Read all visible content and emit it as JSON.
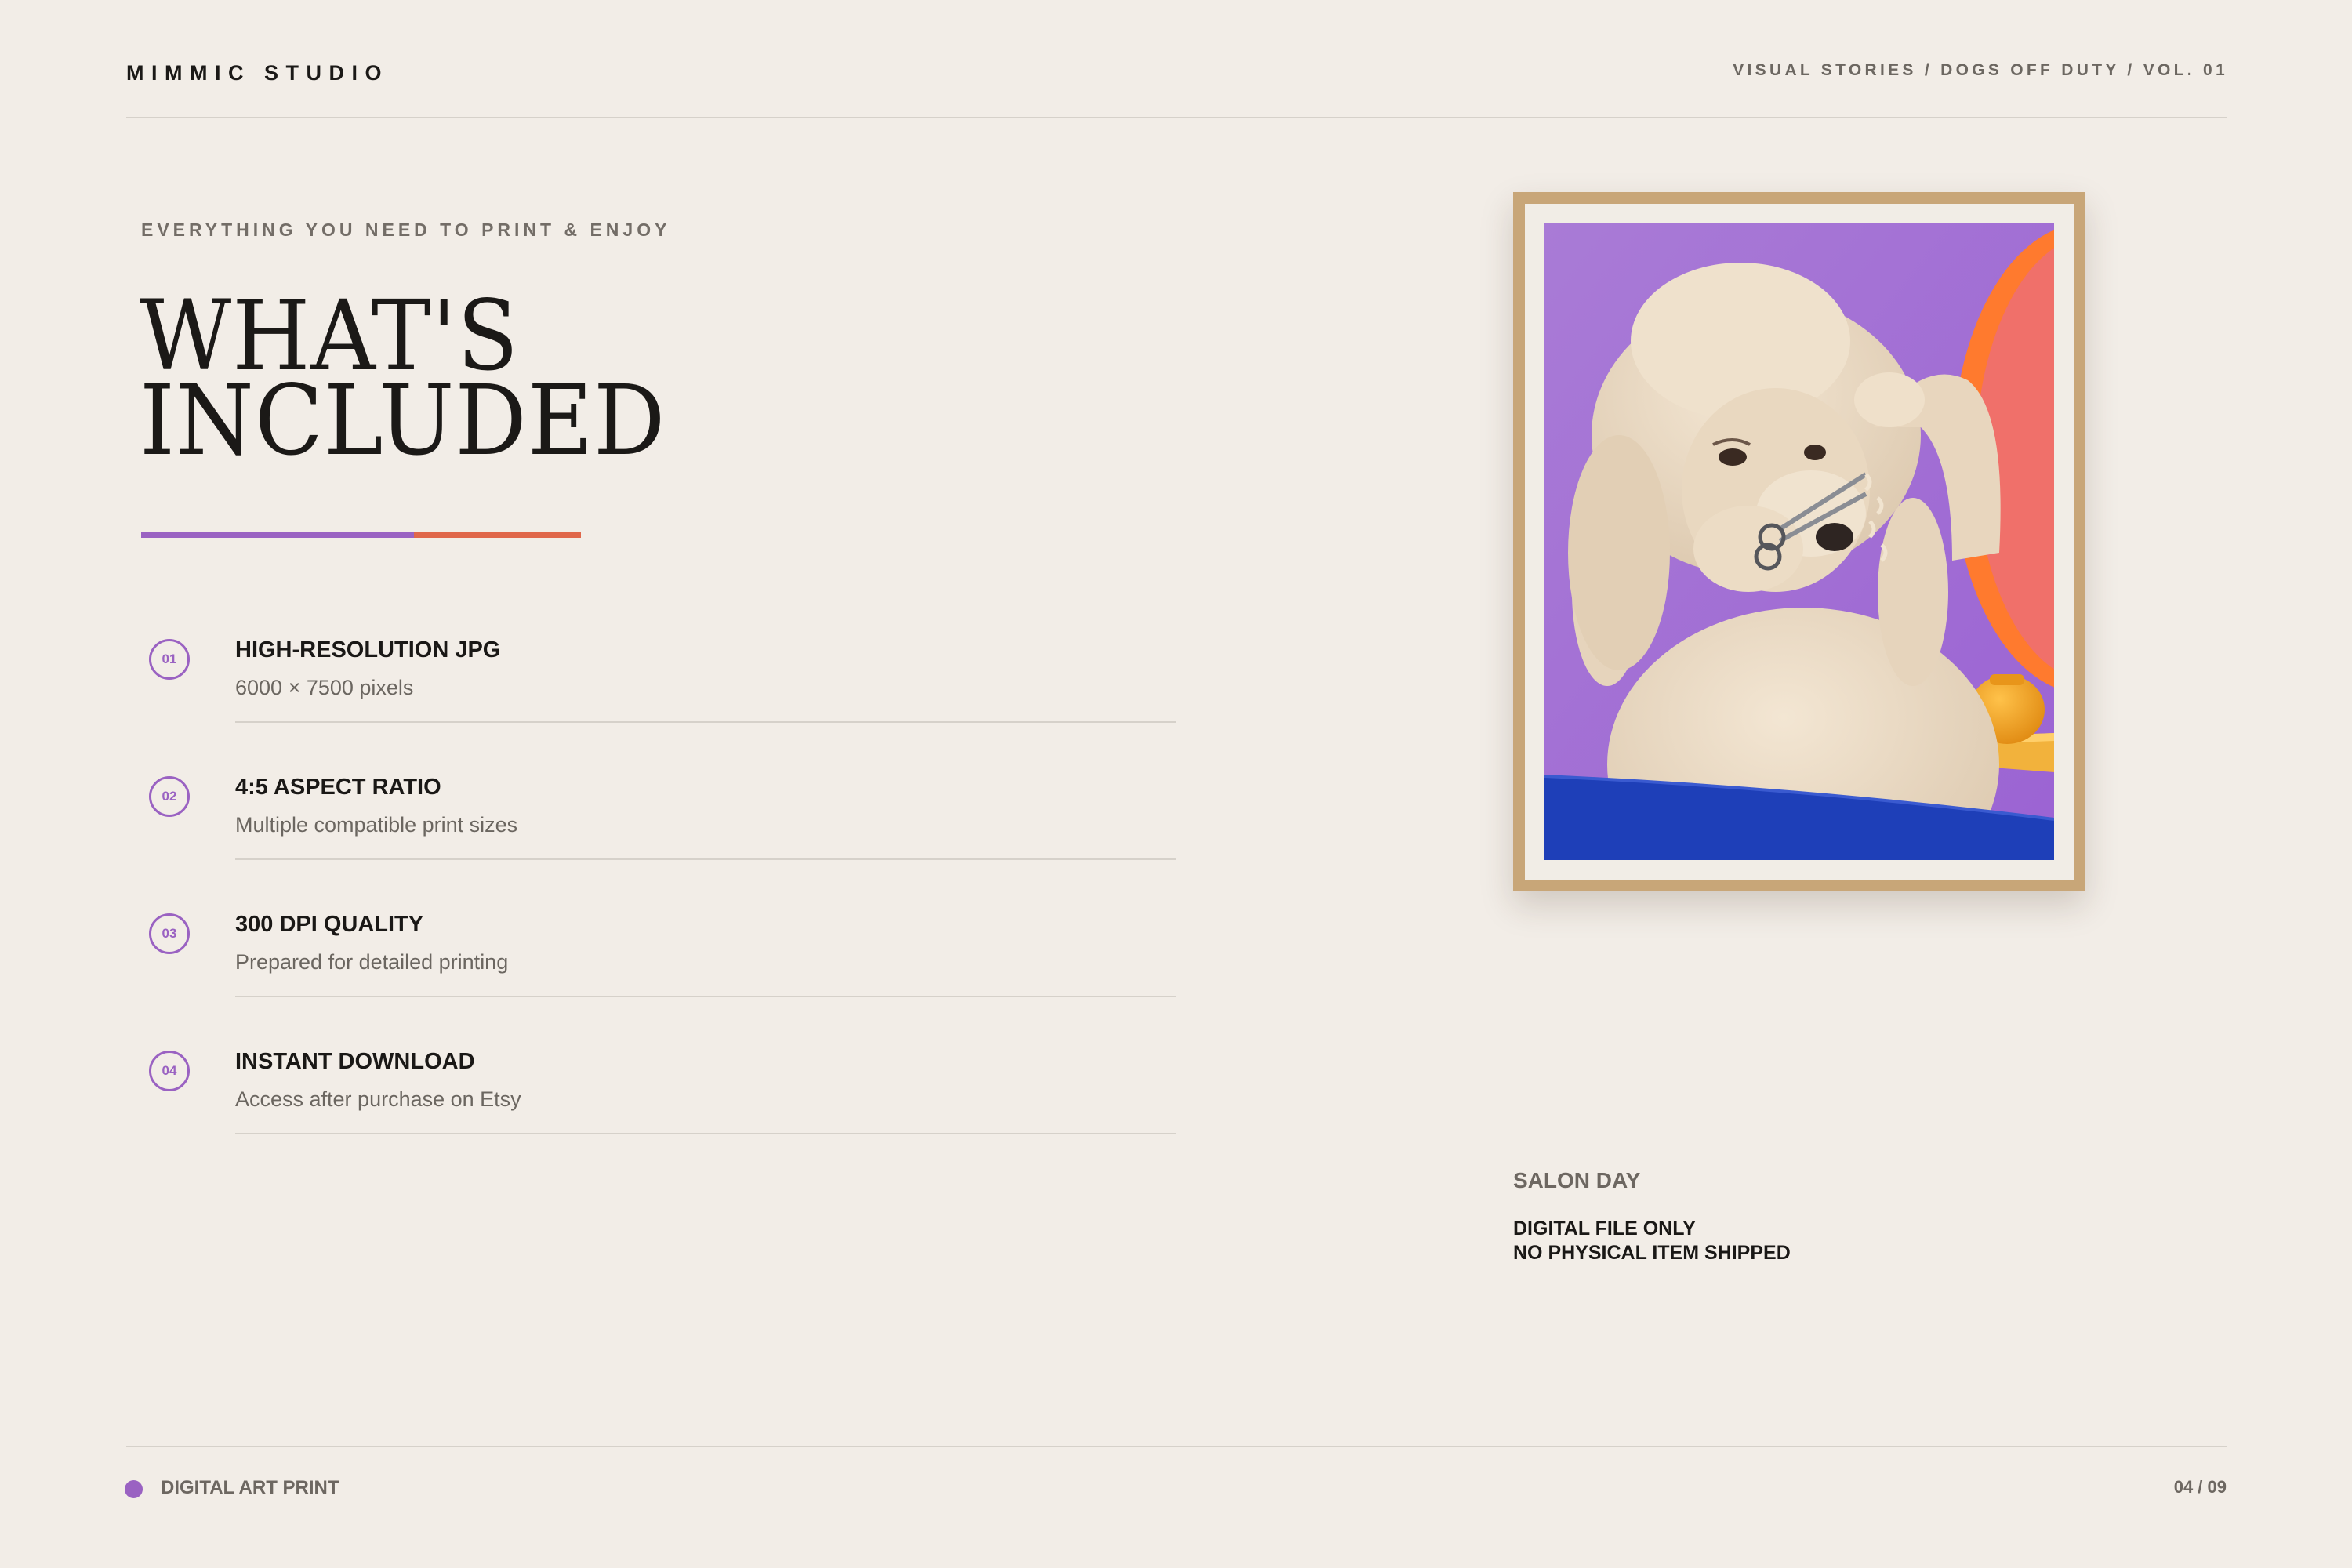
{
  "header": {
    "brand": "MIMMIC STUDIO",
    "breadcrumb": "VISUAL STORIES / DOGS OFF DUTY / VOL. 01"
  },
  "intro": {
    "eyebrow": "EVERYTHING YOU NEED TO PRINT & ENJOY",
    "title_line1": "WHAT'S",
    "title_line2": "INCLUDED"
  },
  "features": [
    {
      "number": "01",
      "title": "HIGH-RESOLUTION JPG",
      "description": "6000 × 7500 pixels"
    },
    {
      "number": "02",
      "title": "4:5 ASPECT RATIO",
      "description": "Multiple compatible print sizes"
    },
    {
      "number": "03",
      "title": "300 DPI QUALITY",
      "description": "Prepared for detailed printing"
    },
    {
      "number": "04",
      "title": "INSTANT DOWNLOAD",
      "description": "Access after purchase on Etsy"
    }
  ],
  "artwork": {
    "title": "SALON DAY",
    "note_line1": "DIGITAL FILE ONLY",
    "note_line2": "NO PHYSICAL ITEM SHIPPED"
  },
  "footer": {
    "label": "DIGITAL ART PRINT",
    "page": "04 / 09"
  },
  "colors": {
    "background": "#f2ede7",
    "accent_purple": "#9a62c2",
    "accent_coral": "#e0674a",
    "frame": "#c8a678"
  }
}
